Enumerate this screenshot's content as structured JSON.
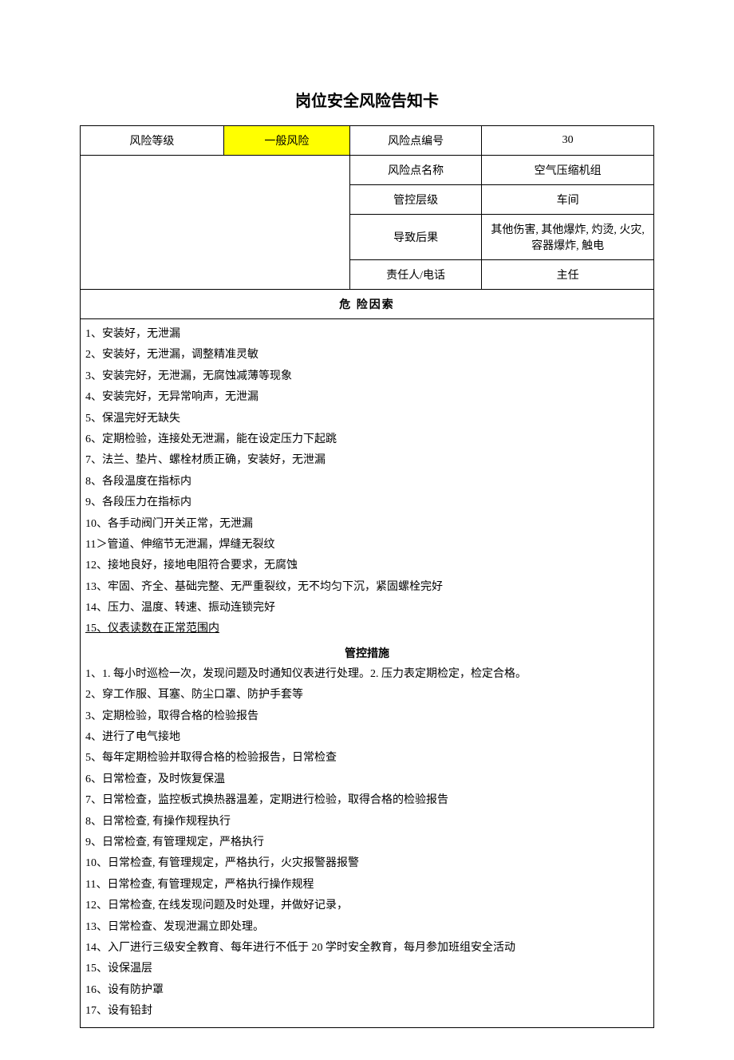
{
  "title": "岗位安全风险告知卡",
  "header_rows": [
    {
      "label": "风险等级",
      "highlight_value": "一般风险",
      "right_label": "风险点编号",
      "right_value": "30"
    },
    {
      "right_label": "风险点名称",
      "right_value": "空气压缩机组"
    },
    {
      "right_label": "管控层级",
      "right_value": "车间"
    },
    {
      "right_label": "导致后果",
      "right_value": "其他伤害, 其他爆炸, 灼烫, 火灾, 容器爆炸, 触电"
    },
    {
      "right_label": "责任人/电话",
      "right_value": "主任"
    }
  ],
  "risk_factors_title": "危 险因索",
  "risk_factors": [
    "1、安装好，无泄漏",
    "2、安装好，无泄漏，调整精准灵敏",
    "3、安装完好，无泄漏，无腐蚀减薄等现象",
    "4、安装完好，无异常响声，无泄漏",
    "5、保温完好无缺失",
    "6、定期检验，连接处无泄漏，能在设定压力下起跳",
    "7、法兰、垫片、螺栓材质正确，安装好，无泄漏",
    "8、各段温度在指标内",
    "9、各段压力在指标内",
    "10、各手动阀门开关正常，无泄漏",
    "11＞管道、伸缩节无泄漏，焊缝无裂纹",
    "12、接地良好，接地电阻符合要求，无腐蚀",
    "13、牢固、齐全、基础完整、无严重裂纹，无不均匀下沉，紧固螺栓完好",
    "14、压力、温度、转速、振动连锁完好"
  ],
  "risk_factors_last": "15、仪表读数在正常范围内",
  "control_measures_title": "管控措施",
  "control_measures": [
    "1、1. 每小时巡检一次，发现问题及时通知仪表进行处理。2. 压力表定期检定，检定合格。",
    "2、穿工作服、耳塞、防尘口罩、防护手套等",
    "3、定期检验，取得合格的检验报告",
    "4、进行了电气接地",
    "5、每年定期检验并取得合格的检验报告，日常检查",
    "6、日常检查，及时恢复保温",
    "7、日常检查，监控板式换热器温差，定期进行检验，取得合格的检验报告",
    "8、日常检查, 有操作规程执行",
    "9、日常检查, 有管理规定，严格执行",
    "10、日常检查, 有管理规定，严格执行，火灾报警器报警",
    "11、日常检查, 有管理规定，严格执行操作规程",
    "12、日常检查, 在线发现问题及时处理，并做好记录，",
    "13、日常检查、发现泄漏立即处理。",
    "14、入厂进行三级安全教育、每年进行不低于 20 学时安全教育，每月参加班组安全活动",
    "15、设保温层",
    "16、设有防护罩",
    "17、设有铅封"
  ]
}
